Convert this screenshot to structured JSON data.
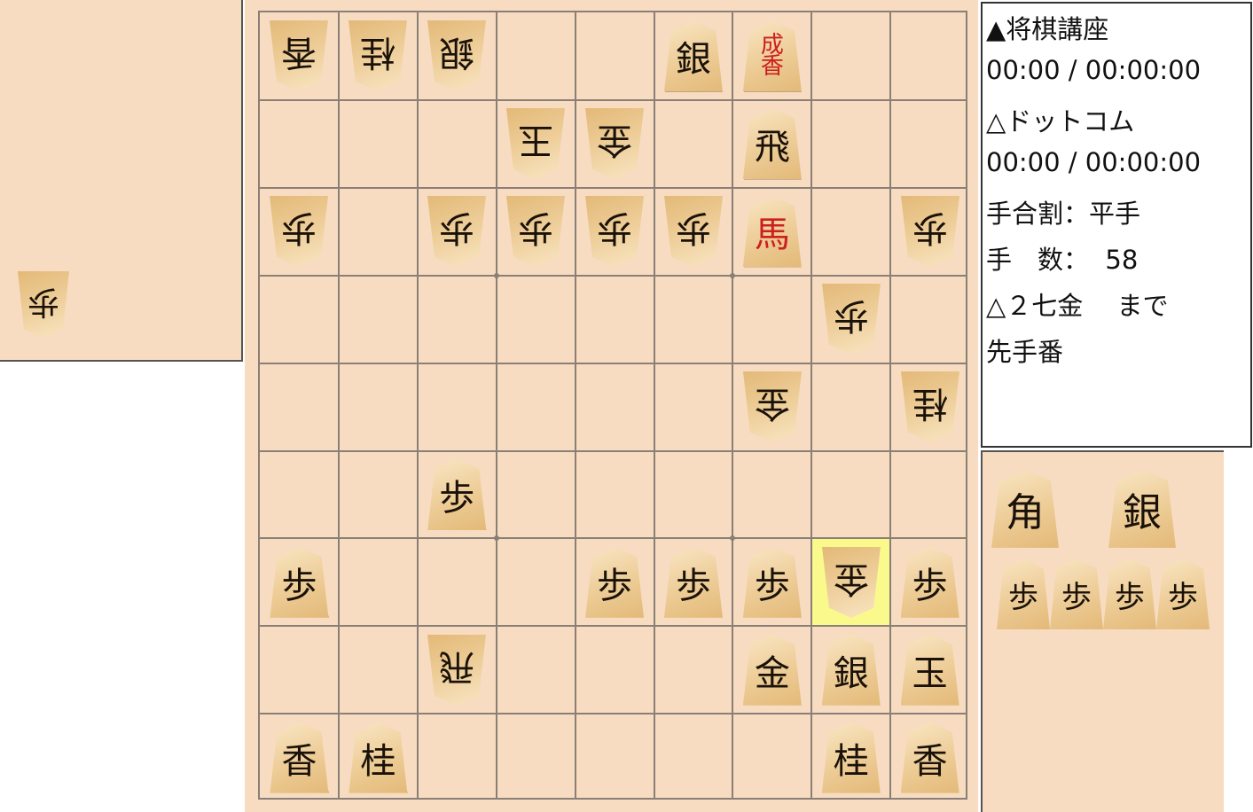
{
  "info": {
    "sente_name": "▲将棋講座",
    "sente_time": "00:00 / 00:00:00",
    "gote_name": "△ドットコム",
    "gote_time": "00:00 / 00:00:00",
    "handicap": "手合割：平手",
    "move_count": "手　数：  58",
    "last_move": "△２七金　 まで",
    "turn": "先手番"
  },
  "board": {
    "last_move_square": {
      "file": 2,
      "rank": 7
    },
    "pieces": [
      {
        "file": 9,
        "rank": 1,
        "label": "香",
        "side": "gote",
        "promoted": false
      },
      {
        "file": 8,
        "rank": 1,
        "label": "桂",
        "side": "gote",
        "promoted": false
      },
      {
        "file": 7,
        "rank": 1,
        "label": "銀",
        "side": "gote",
        "promoted": false
      },
      {
        "file": 4,
        "rank": 1,
        "label": "銀",
        "side": "sente",
        "promoted": false
      },
      {
        "file": 3,
        "rank": 1,
        "label": "成香",
        "side": "sente",
        "promoted": true
      },
      {
        "file": 6,
        "rank": 2,
        "label": "玉",
        "side": "gote",
        "promoted": false
      },
      {
        "file": 5,
        "rank": 2,
        "label": "金",
        "side": "gote",
        "promoted": false
      },
      {
        "file": 3,
        "rank": 2,
        "label": "飛",
        "side": "sente",
        "promoted": false
      },
      {
        "file": 9,
        "rank": 3,
        "label": "歩",
        "side": "gote",
        "promoted": false
      },
      {
        "file": 7,
        "rank": 3,
        "label": "歩",
        "side": "gote",
        "promoted": false
      },
      {
        "file": 6,
        "rank": 3,
        "label": "歩",
        "side": "gote",
        "promoted": false
      },
      {
        "file": 5,
        "rank": 3,
        "label": "歩",
        "side": "gote",
        "promoted": false
      },
      {
        "file": 4,
        "rank": 3,
        "label": "歩",
        "side": "gote",
        "promoted": false
      },
      {
        "file": 3,
        "rank": 3,
        "label": "馬",
        "side": "sente",
        "promoted": true
      },
      {
        "file": 1,
        "rank": 3,
        "label": "歩",
        "side": "gote",
        "promoted": false
      },
      {
        "file": 2,
        "rank": 4,
        "label": "歩",
        "side": "gote",
        "promoted": false
      },
      {
        "file": 3,
        "rank": 5,
        "label": "金",
        "side": "gote",
        "promoted": false
      },
      {
        "file": 1,
        "rank": 5,
        "label": "桂",
        "side": "gote",
        "promoted": false
      },
      {
        "file": 7,
        "rank": 6,
        "label": "歩",
        "side": "sente",
        "promoted": false
      },
      {
        "file": 9,
        "rank": 7,
        "label": "歩",
        "side": "sente",
        "promoted": false
      },
      {
        "file": 5,
        "rank": 7,
        "label": "歩",
        "side": "sente",
        "promoted": false
      },
      {
        "file": 4,
        "rank": 7,
        "label": "歩",
        "side": "sente",
        "promoted": false
      },
      {
        "file": 3,
        "rank": 7,
        "label": "歩",
        "side": "sente",
        "promoted": false
      },
      {
        "file": 2,
        "rank": 7,
        "label": "金",
        "side": "gote",
        "promoted": false
      },
      {
        "file": 1,
        "rank": 7,
        "label": "歩",
        "side": "sente",
        "promoted": false
      },
      {
        "file": 7,
        "rank": 8,
        "label": "飛",
        "side": "gote",
        "promoted": false
      },
      {
        "file": 3,
        "rank": 8,
        "label": "金",
        "side": "sente",
        "promoted": false
      },
      {
        "file": 2,
        "rank": 8,
        "label": "銀",
        "side": "sente",
        "promoted": false
      },
      {
        "file": 1,
        "rank": 8,
        "label": "玉",
        "side": "sente",
        "promoted": false
      },
      {
        "file": 9,
        "rank": 9,
        "label": "香",
        "side": "sente",
        "promoted": false
      },
      {
        "file": 8,
        "rank": 9,
        "label": "桂",
        "side": "sente",
        "promoted": false
      },
      {
        "file": 2,
        "rank": 9,
        "label": "桂",
        "side": "sente",
        "promoted": false
      },
      {
        "file": 1,
        "rank": 9,
        "label": "香",
        "side": "sente",
        "promoted": false
      }
    ]
  },
  "gote_hand": [
    {
      "label": "歩"
    }
  ],
  "sente_hand": [
    {
      "label": "角"
    },
    {
      "label": "銀"
    },
    {
      "label": "歩"
    },
    {
      "label": "歩"
    },
    {
      "label": "歩"
    },
    {
      "label": "歩"
    }
  ],
  "colors": {
    "board": "#f7dcc2",
    "grid": "#8a7f76",
    "highlight": "#fafa8c",
    "promoted": "#cc1f1f"
  }
}
